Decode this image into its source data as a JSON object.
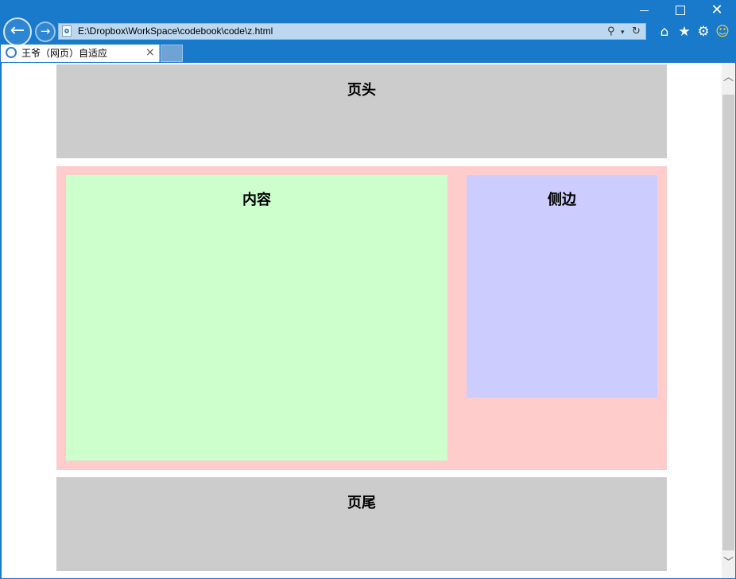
{
  "browser": {
    "address_url": "E:\\Dropbox\\WorkSpace\\codebook\\code\\z.html",
    "tab_title": "王爷（网页）自适应",
    "tab_close": "×",
    "icons": [
      "back-icon",
      "forward-icon",
      "search-icon",
      "refresh-icon",
      "home-icon",
      "star-icon",
      "gear-icon",
      "smiley-icon"
    ]
  },
  "page": {
    "header_title": "页头",
    "content_title": "内容",
    "sidebar_title": "侧边",
    "footer_title": "页尾"
  },
  "colors": {
    "header": "#cccccc",
    "main": "#ffcccc",
    "content": "#ccffcc",
    "sidebar": "#ccccff",
    "footer": "#cccccc",
    "chrome": "#1979ca"
  }
}
